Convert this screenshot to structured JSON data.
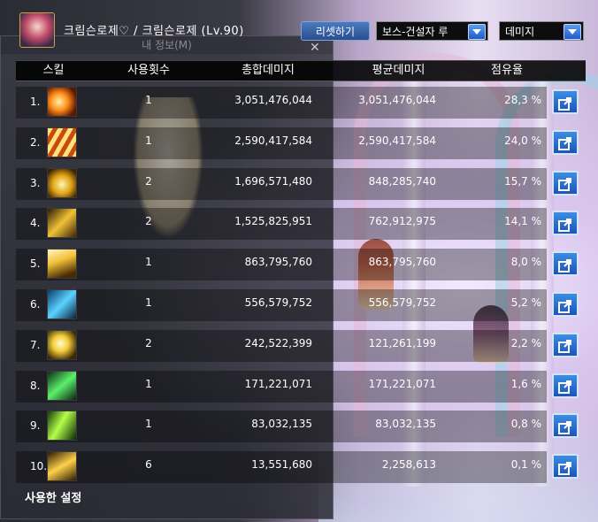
{
  "window": {
    "character_name": "크림슨로제♡ / 크림슨로제 (Lv.90)",
    "background_window_title": "내 정보(M)"
  },
  "controls": {
    "reset_label": "리셋하기",
    "boss_filter_value": "보스-건설자 루",
    "metric_value": "데미지"
  },
  "table": {
    "headers": {
      "skill": "스킬",
      "uses": "사용횟수",
      "total": "총합데미지",
      "average": "평균데미지",
      "share": "점유율"
    },
    "rows": [
      {
        "rank": "1.",
        "icon": "flame-burst-icon",
        "uses": "1",
        "total": "3,051,476,044",
        "average": "3,051,476,044",
        "share": "28,3 %"
      },
      {
        "rank": "2.",
        "icon": "fire-pillars-icon",
        "uses": "1",
        "total": "2,590,417,584",
        "average": "2,590,417,584",
        "share": "24,0 %"
      },
      {
        "rank": "3.",
        "icon": "golden-swirl-icon",
        "uses": "2",
        "total": "1,696,571,480",
        "average": "848,285,740",
        "share": "15,7 %"
      },
      {
        "rank": "4.",
        "icon": "golden-runes-icon",
        "uses": "2",
        "total": "1,525,825,951",
        "average": "762,912,975",
        "share": "14,1 %"
      },
      {
        "rank": "5.",
        "icon": "light-rays-icon",
        "uses": "1",
        "total": "863,795,760",
        "average": "863,795,760",
        "share": "8,0 %"
      },
      {
        "rank": "6.",
        "icon": "ice-strike-icon",
        "uses": "1",
        "total": "556,579,752",
        "average": "556,579,752",
        "share": "5,2 %"
      },
      {
        "rank": "7.",
        "icon": "star-burst-icon",
        "uses": "2",
        "total": "242,522,399",
        "average": "121,261,199",
        "share": "2,2 %"
      },
      {
        "rank": "8.",
        "icon": "green-slash-icon",
        "uses": "1",
        "total": "171,221,071",
        "average": "171,221,071",
        "share": "1,6 %"
      },
      {
        "rank": "9.",
        "icon": "green-arrow-icon",
        "uses": "1",
        "total": "83,032,135",
        "average": "83,032,135",
        "share": "0,8 %"
      },
      {
        "rank": "10.",
        "icon": "golden-wing-icon",
        "uses": "6",
        "total": "13,551,680",
        "average": "2,258,613",
        "share": "0,1 %"
      }
    ]
  },
  "footer": {
    "used_setting_label": "사용한 설정"
  },
  "colors": {
    "detail_button": "#2a6fd1",
    "reset_button": "#3a64a8"
  }
}
